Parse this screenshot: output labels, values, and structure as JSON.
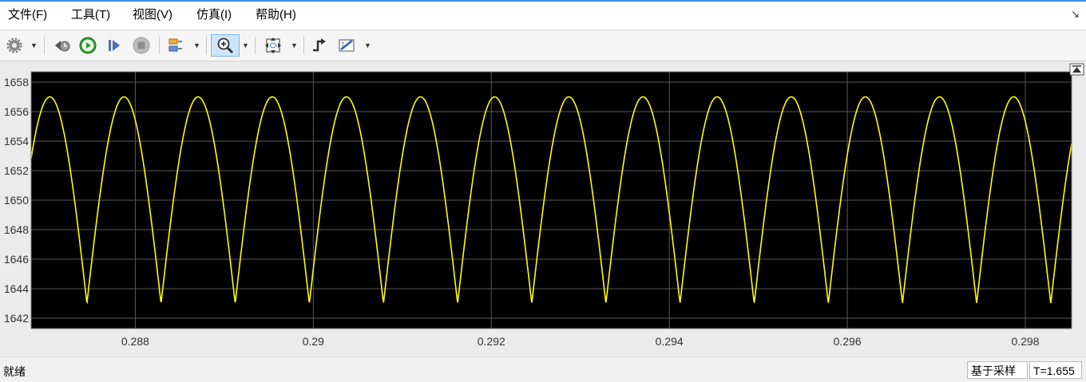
{
  "menu": {
    "items": [
      "文件(F)",
      "工具(T)",
      "视图(V)",
      "仿真(I)",
      "帮助(H)"
    ]
  },
  "toolbar": {
    "icons": [
      "gear-icon",
      "step-back-icon",
      "run-icon",
      "step-forward-icon",
      "stop-icon",
      "layout-icon",
      "zoom-in-icon",
      "fit-to-view-icon",
      "trigger-icon",
      "measurement-icon"
    ]
  },
  "colors": {
    "plot_bg": "#000000",
    "trace": "#ffff00",
    "grid": "#5a5a5a",
    "axis_text": "#333333"
  },
  "chart_data": {
    "type": "line",
    "series": [
      {
        "description": "full-wave rectified ripple",
        "peak": 1657,
        "trough": 1643,
        "period": 0.000833,
        "first_peak_x": 0.28704
      }
    ],
    "xlim": [
      0.28683,
      0.29852
    ],
    "ylim": [
      1641.3,
      1658.7
    ],
    "xticks": [
      "0.288",
      "0.29",
      "0.292",
      "0.294",
      "0.296",
      "0.298"
    ],
    "yticks": [
      "1642",
      "1644",
      "1646",
      "1648",
      "1650",
      "1652",
      "1654",
      "1656",
      "1658"
    ],
    "xtick_values": [
      0.288,
      0.29,
      0.292,
      0.294,
      0.296,
      0.298
    ],
    "ytick_values": [
      1642,
      1644,
      1646,
      1648,
      1650,
      1652,
      1654,
      1656,
      1658
    ],
    "grid": true
  },
  "status": {
    "left": "就绪",
    "mode": "基于采样",
    "time": "T=1.655"
  }
}
